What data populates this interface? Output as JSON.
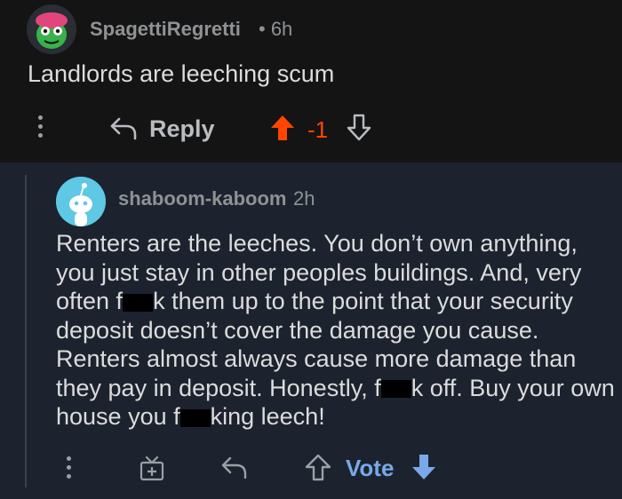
{
  "parent_comment": {
    "username": "SpagettiRegretti",
    "time": "• 6h",
    "body": "Landlords are leeching scum",
    "reply_label": "Reply",
    "score": "-1",
    "colors": {
      "upvote_active": "#ff4500",
      "text": "#dcdcdc",
      "meta": "#8f9295"
    }
  },
  "reply_comment": {
    "username": "shaboom-kaboom",
    "time": "2h",
    "body_parts": {
      "p1": "Renters are the leeches. You don’t own anything, you just stay in other peoples buildings. And, very often f",
      "p2": "k them up to the point that your security deposit doesn’t cover the damage you cause. Renters almost always cause more damage than they pay in deposit. Honestly, f",
      "p3": "k off. Buy your own house you f",
      "p4": "king leech!"
    },
    "vote_label": "Vote",
    "colors": {
      "vote": "#7aa8e8",
      "downvote_active": "#7aa8e8"
    }
  },
  "icons": [
    "more-icon",
    "reply-arrow-icon",
    "upvote-arrow-icon",
    "downvote-arrow-icon",
    "award-icon",
    "redaction-block"
  ]
}
